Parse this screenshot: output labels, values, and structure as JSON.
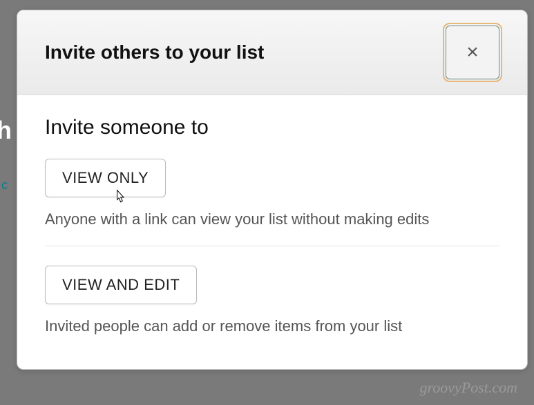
{
  "modal": {
    "title": "Invite others to your list",
    "close_label": "×",
    "subtitle": "Invite someone to",
    "options": [
      {
        "button_label": "VIEW ONLY",
        "description": "Anyone with a link can view your list without making edits"
      },
      {
        "button_label": "VIEW AND EDIT",
        "description": "Invited people can add or remove items from your list"
      }
    ]
  },
  "watermark": "groovyPost.com"
}
